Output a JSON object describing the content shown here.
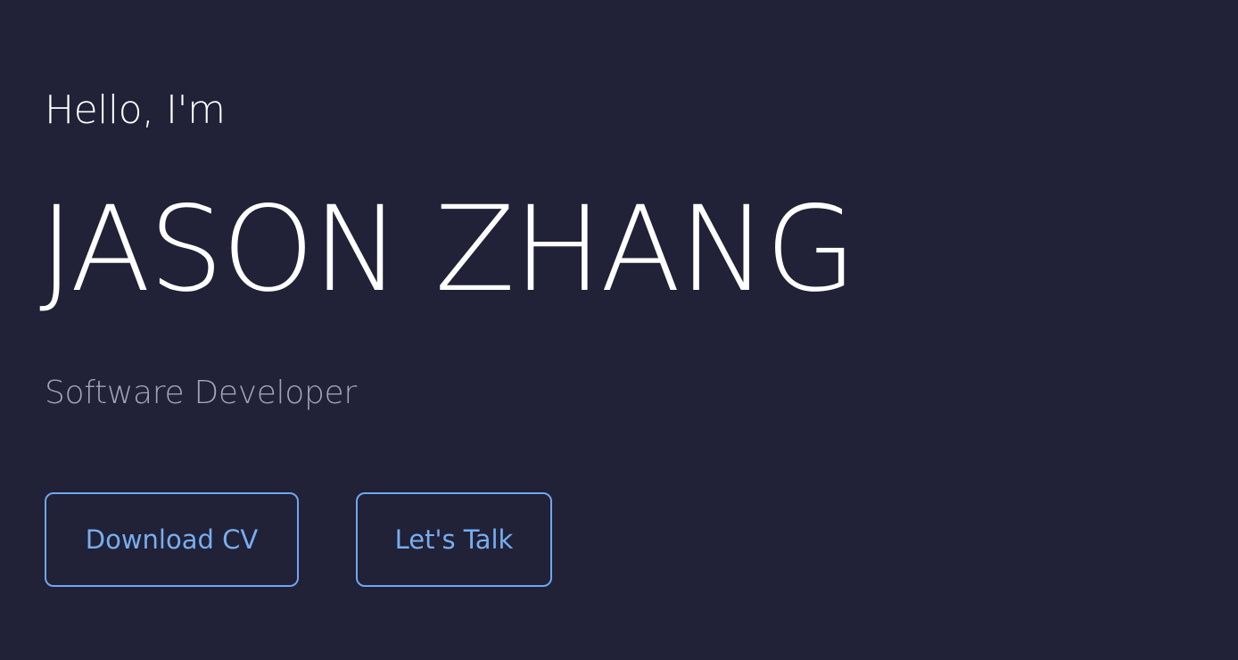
{
  "hero": {
    "greeting": "Hello, I'm",
    "name": "JASON ZHANG",
    "role": "Software Developer",
    "buttons": {
      "download_label": "Download CV",
      "talk_label": "Let's Talk"
    }
  },
  "colors": {
    "background": "#212137",
    "text_primary": "#ffffff",
    "text_secondary": "#a3a3b3",
    "accent": "#6fa7ef"
  }
}
